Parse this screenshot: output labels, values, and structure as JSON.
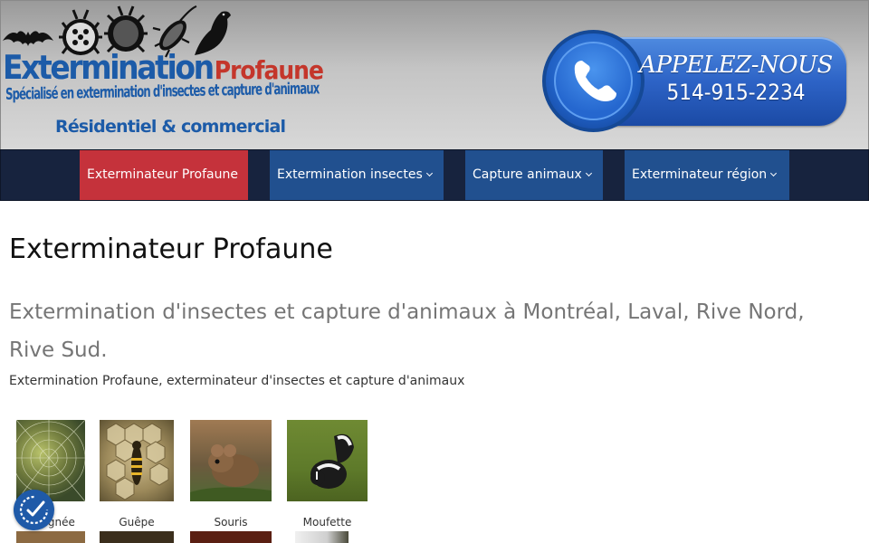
{
  "header": {
    "logo_title": "Extermination",
    "logo_title_accent": "Profaune",
    "logo_subtitle": "Spécialisé en extermination d'insectes et capture d'animaux",
    "logo_subtitle2": "Résidentiel & commercial",
    "call_label": "APPELEZ-NOUS",
    "call_number": "514-915-2234"
  },
  "nav": {
    "items": [
      {
        "label": "Exterminateur Profaune"
      },
      {
        "label": "Extermination insectes"
      },
      {
        "label": "Capture animaux"
      },
      {
        "label": "Exterminateur région"
      }
    ]
  },
  "main": {
    "title": "Exterminateur Profaune",
    "subtitle": "Extermination d'insectes et capture d'animaux à Montréal, Laval, Rive Nord, Rive Sud.",
    "intro": "Extermination Profaune, exterminateur d'insectes et capture d'animaux",
    "gallery": [
      {
        "caption": "Araignée"
      },
      {
        "caption": "Guêpe"
      },
      {
        "caption": "Souris"
      },
      {
        "caption": "Moufette"
      }
    ]
  },
  "icons": {
    "phone": "phone-icon",
    "accessibility": "accessibility-icon",
    "dropdown": "chevron-down-icon"
  },
  "colors": {
    "brand_blue": "#1c5ba8",
    "brand_red": "#c4362b",
    "nav_bg": "#17233e",
    "nav_active": "#c5323b",
    "nav_item": "#21508f"
  }
}
